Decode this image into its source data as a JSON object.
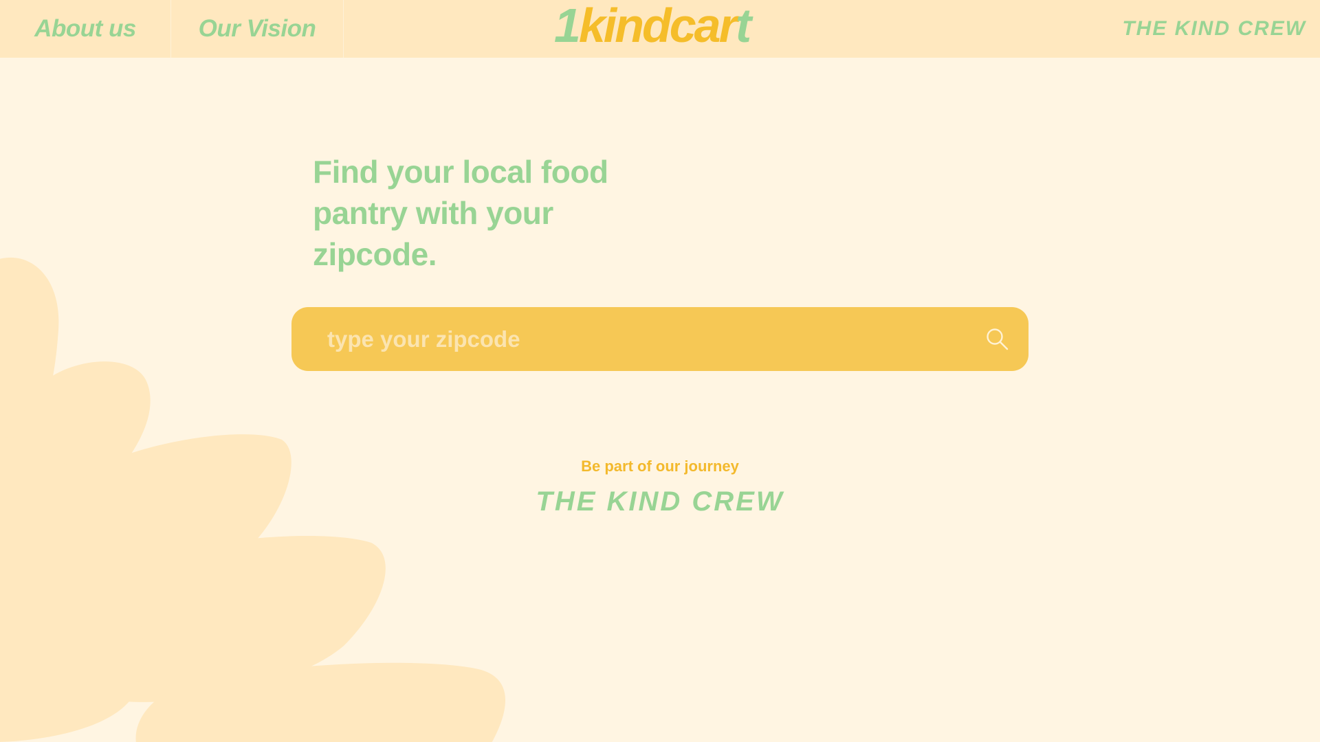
{
  "nav": {
    "about_label": "About us",
    "vision_label": "Our Vision"
  },
  "logo": {
    "lead": "1",
    "main": "kindcar",
    "trail": "t"
  },
  "crew_link": "THE KIND CREW",
  "hero": {
    "headline": "Find your local food pantry with your zipcode."
  },
  "search": {
    "value": "",
    "placeholder": "type your zipcode",
    "icon": "search-icon"
  },
  "journey": {
    "tagline": "Be part of our journey",
    "crew_label": "THE KIND CREW"
  },
  "colors": {
    "page_background": "#fff5e2",
    "header_background": "#ffe8bf",
    "green_accent": "#98d494",
    "yellow_accent": "#f6c855",
    "gold_text": "#f3b92c",
    "petal": "#ffe8bf"
  }
}
